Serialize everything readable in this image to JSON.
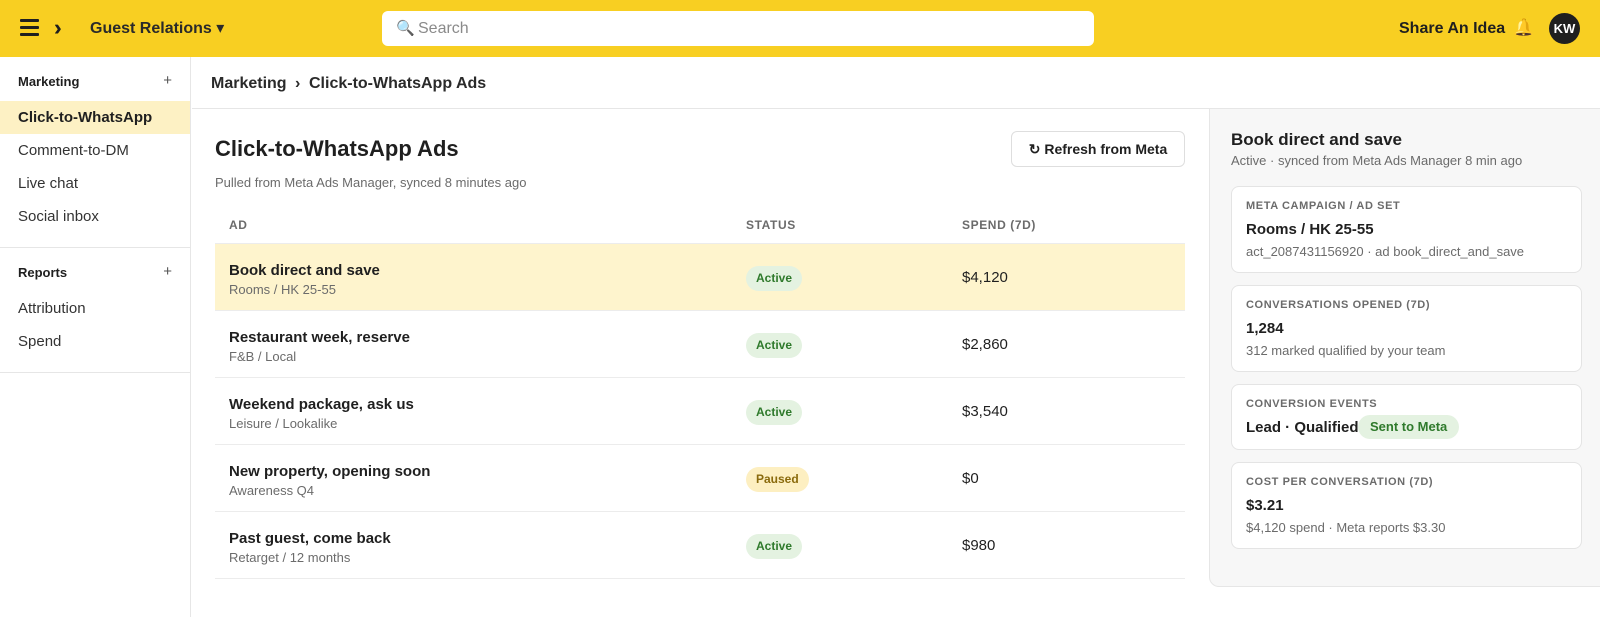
{
  "topbar": {
    "workspace": "Guest Relations ▾",
    "search_placeholder": "Search",
    "share_link": "Share An Idea",
    "bell_glyph": "🔔",
    "avatar_initials": "KW",
    "accent_color": "#f8cf22"
  },
  "sidebar": {
    "sections": [
      {
        "title": "Marketing",
        "items": [
          "Click-to-WhatsApp",
          "Comment-to-DM",
          "Live chat",
          "Social inbox"
        ]
      },
      {
        "title": "Reports",
        "items": [
          "Attribution",
          "Spend"
        ]
      }
    ],
    "active_item": "Click-to-WhatsApp"
  },
  "breadcrumb": {
    "parent": "Marketing",
    "separator": "›",
    "current": "Click-to-WhatsApp Ads"
  },
  "main": {
    "title": "Click-to-WhatsApp Ads",
    "subtitle": "Pulled from Meta Ads Manager, synced 8 minutes ago",
    "refresh_label": "↻ Refresh from Meta",
    "columns": [
      "AD",
      "STATUS",
      "SPEND (7D)"
    ],
    "rows": [
      {
        "name": "Book direct and save",
        "target": "Rooms / HK 25-55",
        "status": "Active",
        "spend": "$4,120"
      },
      {
        "name": "Restaurant week, reserve",
        "target": "F&B / Local",
        "status": "Active",
        "spend": "$2,860"
      },
      {
        "name": "Weekend package, ask us",
        "target": "Leisure / Lookalike",
        "status": "Active",
        "spend": "$3,540"
      },
      {
        "name": "New property, opening soon",
        "target": "Awareness Q4",
        "status": "Paused",
        "spend": "$0"
      },
      {
        "name": "Past guest, come back",
        "target": "Retarget / 12 months",
        "status": "Active",
        "spend": "$980"
      }
    ]
  },
  "detail": {
    "title": "Book direct and save",
    "subtitle": "Active · synced from Meta Ads Manager 8 min ago",
    "cards": [
      {
        "label": "META CAMPAIGN / AD SET",
        "value": "Rooms / HK 25-55",
        "note": "act_2087431156920 · ad book_direct_and_save"
      },
      {
        "label": "CONVERSATIONS OPENED (7D)",
        "value": "1,284",
        "note": "312 marked qualified by your team"
      },
      {
        "label": "CONVERSION EVENTS",
        "value": "Lead · Qualified",
        "badge": "Sent to Meta"
      },
      {
        "label": "COST PER CONVERSATION (7D)",
        "value": "$3.21",
        "note": "$4,120 spend · Meta reports $3.30"
      }
    ]
  }
}
